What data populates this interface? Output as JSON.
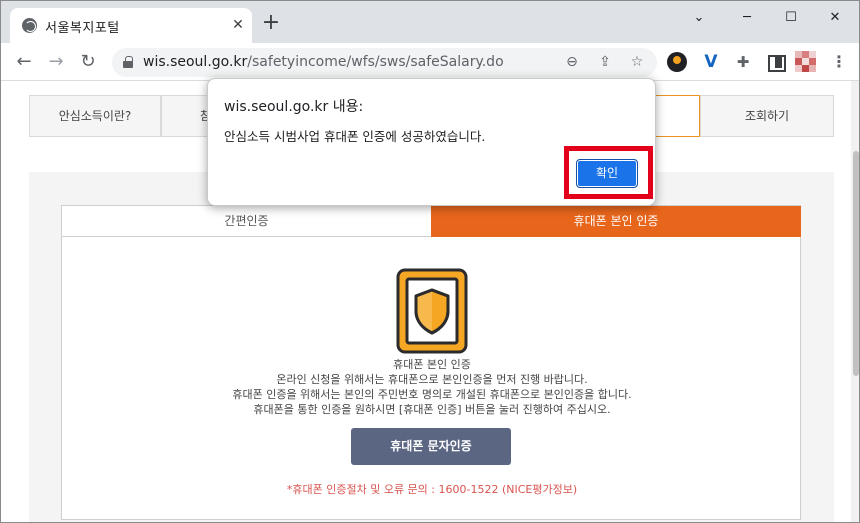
{
  "browser": {
    "tab_title": "서울복지포털",
    "tab_close": "✕",
    "new_tab": "+",
    "window_controls": {
      "minimize": "─",
      "maximize": "☐",
      "close": "✕",
      "tab_search": "⌄"
    },
    "url_domain": "wis.seoul.go.kr",
    "url_path": "/safetyincome/wfs/sws/safeSalary.do"
  },
  "icons": {
    "back": "back-arrow-icon",
    "forward": "forward-arrow-icon",
    "reload": "reload-icon",
    "lock": "lock-icon",
    "zoom": "zoom-icon",
    "share": "share-icon",
    "bookmark": "star-icon",
    "extensions": [
      "ublock-extension-icon",
      "v-extension-icon",
      "puzzle-extension-icon",
      "side-panel-icon"
    ],
    "profile": "profile-avatar-icon",
    "menu": "kebab-menu-icon",
    "shield": "phone-shield-icon"
  },
  "nav_tabs": {
    "intro": "안심소득이란?",
    "second": "참",
    "last": "조회하기"
  },
  "auth": {
    "tab_simple": "간편인증",
    "tab_phone": "휴대폰 본인 인증",
    "heading": "휴대폰 본인 인증",
    "line1": "온라인 신청을 위해서는 휴대폰으로 본인인증을 먼저 진행 바랍니다.",
    "line2": "휴대폰 인증을 위해서는 본인의 주민번호 명의로 개설된 휴대폰으로 본인인증을 합니다.",
    "line3": "휴대폰을 통한 인증을 원하시면 [휴대폰 인증] 버튼을 눌러 진행하여 주십시오.",
    "button": "휴대폰 문자인증",
    "contact": "*휴대폰 인증절차 및 오류 문의 : 1600-1522 (NICE평가정보)"
  },
  "dialog": {
    "origin": "wis.seoul.go.kr 내용:",
    "message": "안심소득 시범사업 휴대폰 인증에 성공하였습니다.",
    "ok_label": "확인"
  },
  "colors": {
    "accent_orange": "#e8661c",
    "button_slate": "#5b6682",
    "dialog_blue": "#1a73e8",
    "highlight_red": "#e3001b",
    "contact_red": "#d9534f"
  }
}
